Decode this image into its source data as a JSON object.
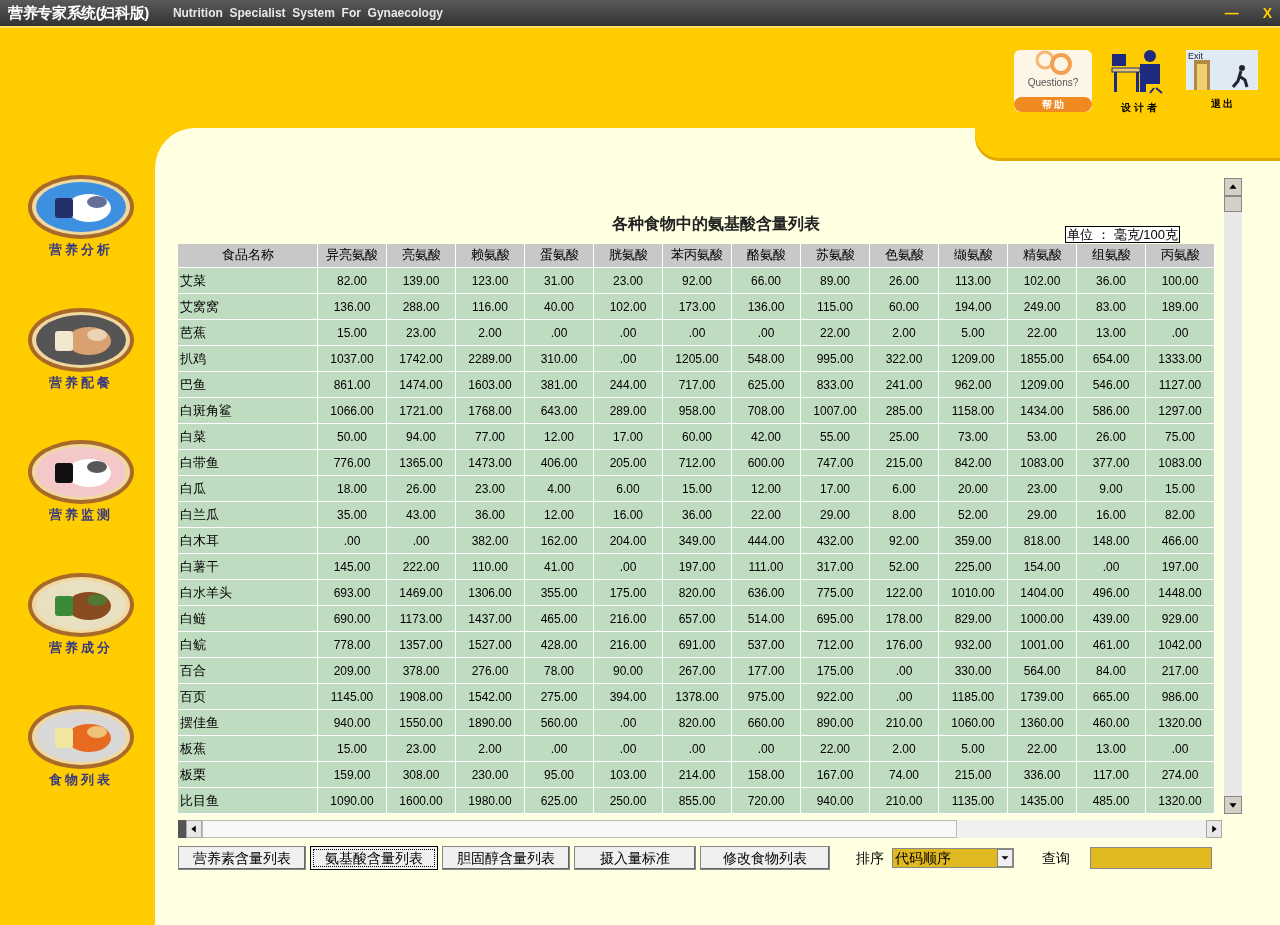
{
  "window": {
    "title": "营养专家系统(妇科版)",
    "subtitle": "Nutrition  Specialist  System  For  Gynaecology",
    "minimize": "—",
    "close": "X"
  },
  "toolbar": [
    {
      "kind": "help",
      "caption": "Questions?",
      "label": "帮 助"
    },
    {
      "kind": "designer",
      "label": "设 计 者"
    },
    {
      "kind": "exit",
      "caption": "Exit",
      "label": "退 出"
    }
  ],
  "sidebar": [
    {
      "kind": "analysis",
      "label": "营养分析"
    },
    {
      "kind": "meal",
      "label": "营养配餐"
    },
    {
      "kind": "monitor",
      "label": "营养监测"
    },
    {
      "kind": "ingredients",
      "label": "营养成分"
    },
    {
      "kind": "foods",
      "label": "食物列表"
    }
  ],
  "table": {
    "title": "各种食物中的氨基酸含量列表",
    "unit": "单位 ： 毫克/100克",
    "columns": [
      "食品名称",
      "异亮氨酸",
      "亮氨酸",
      "赖氨酸",
      "蛋氨酸",
      "胱氨酸",
      "苯丙氨酸",
      "酪氨酸",
      "苏氨酸",
      "色氨酸",
      "缬氨酸",
      "精氨酸",
      "组氨酸",
      "丙氨酸"
    ],
    "rows": [
      {
        "name": "艾菜",
        "values": [
          "82.00",
          "139.00",
          "123.00",
          "31.00",
          "23.00",
          "92.00",
          "66.00",
          "89.00",
          "26.00",
          "113.00",
          "102.00",
          "36.00",
          "100.00"
        ]
      },
      {
        "name": "艾窝窝",
        "values": [
          "136.00",
          "288.00",
          "116.00",
          "40.00",
          "102.00",
          "173.00",
          "136.00",
          "115.00",
          "60.00",
          "194.00",
          "249.00",
          "83.00",
          "189.00"
        ]
      },
      {
        "name": "芭蕉",
        "values": [
          "15.00",
          "23.00",
          "2.00",
          ".00",
          ".00",
          ".00",
          ".00",
          "22.00",
          "2.00",
          "5.00",
          "22.00",
          "13.00",
          ".00"
        ]
      },
      {
        "name": "扒鸡",
        "values": [
          "1037.00",
          "1742.00",
          "2289.00",
          "310.00",
          ".00",
          "1205.00",
          "548.00",
          "995.00",
          "322.00",
          "1209.00",
          "1855.00",
          "654.00",
          "1333.00"
        ]
      },
      {
        "name": "巴鱼",
        "values": [
          "861.00",
          "1474.00",
          "1603.00",
          "381.00",
          "244.00",
          "717.00",
          "625.00",
          "833.00",
          "241.00",
          "962.00",
          "1209.00",
          "546.00",
          "1127.00"
        ]
      },
      {
        "name": "白斑角鲨",
        "values": [
          "1066.00",
          "1721.00",
          "1768.00",
          "643.00",
          "289.00",
          "958.00",
          "708.00",
          "1007.00",
          "285.00",
          "1158.00",
          "1434.00",
          "586.00",
          "1297.00"
        ]
      },
      {
        "name": "白菜",
        "values": [
          "50.00",
          "94.00",
          "77.00",
          "12.00",
          "17.00",
          "60.00",
          "42.00",
          "55.00",
          "25.00",
          "73.00",
          "53.00",
          "26.00",
          "75.00"
        ]
      },
      {
        "name": "白带鱼",
        "values": [
          "776.00",
          "1365.00",
          "1473.00",
          "406.00",
          "205.00",
          "712.00",
          "600.00",
          "747.00",
          "215.00",
          "842.00",
          "1083.00",
          "377.00",
          "1083.00"
        ]
      },
      {
        "name": "白瓜",
        "values": [
          "18.00",
          "26.00",
          "23.00",
          "4.00",
          "6.00",
          "15.00",
          "12.00",
          "17.00",
          "6.00",
          "20.00",
          "23.00",
          "9.00",
          "15.00"
        ]
      },
      {
        "name": "白兰瓜",
        "values": [
          "35.00",
          "43.00",
          "36.00",
          "12.00",
          "16.00",
          "36.00",
          "22.00",
          "29.00",
          "8.00",
          "52.00",
          "29.00",
          "16.00",
          "82.00"
        ]
      },
      {
        "name": "白木耳",
        "values": [
          ".00",
          ".00",
          "382.00",
          "162.00",
          "204.00",
          "349.00",
          "444.00",
          "432.00",
          "92.00",
          "359.00",
          "818.00",
          "148.00",
          "466.00"
        ]
      },
      {
        "name": "白薯干",
        "values": [
          "145.00",
          "222.00",
          "110.00",
          "41.00",
          ".00",
          "197.00",
          "111.00",
          "317.00",
          "52.00",
          "225.00",
          "154.00",
          ".00",
          "197.00"
        ]
      },
      {
        "name": "白水羊头",
        "values": [
          "693.00",
          "1469.00",
          "1306.00",
          "355.00",
          "175.00",
          "820.00",
          "636.00",
          "775.00",
          "122.00",
          "1010.00",
          "1404.00",
          "496.00",
          "1448.00"
        ]
      },
      {
        "name": "白鲢",
        "values": [
          "690.00",
          "1173.00",
          "1437.00",
          "465.00",
          "216.00",
          "657.00",
          "514.00",
          "695.00",
          "178.00",
          "829.00",
          "1000.00",
          "439.00",
          "929.00"
        ]
      },
      {
        "name": "白鲩",
        "values": [
          "778.00",
          "1357.00",
          "1527.00",
          "428.00",
          "216.00",
          "691.00",
          "537.00",
          "712.00",
          "176.00",
          "932.00",
          "1001.00",
          "461.00",
          "1042.00"
        ]
      },
      {
        "name": "百合",
        "values": [
          "209.00",
          "378.00",
          "276.00",
          "78.00",
          "90.00",
          "267.00",
          "177.00",
          "175.00",
          ".00",
          "330.00",
          "564.00",
          "84.00",
          "217.00"
        ]
      },
      {
        "name": "百页",
        "values": [
          "1145.00",
          "1908.00",
          "1542.00",
          "275.00",
          "394.00",
          "1378.00",
          "975.00",
          "922.00",
          ".00",
          "1185.00",
          "1739.00",
          "665.00",
          "986.00"
        ]
      },
      {
        "name": "摆佳鱼",
        "values": [
          "940.00",
          "1550.00",
          "1890.00",
          "560.00",
          ".00",
          "820.00",
          "660.00",
          "890.00",
          "210.00",
          "1060.00",
          "1360.00",
          "460.00",
          "1320.00"
        ]
      },
      {
        "name": "板蕉",
        "values": [
          "15.00",
          "23.00",
          "2.00",
          ".00",
          ".00",
          ".00",
          ".00",
          "22.00",
          "2.00",
          "5.00",
          "22.00",
          "13.00",
          ".00"
        ]
      },
      {
        "name": "板栗",
        "values": [
          "159.00",
          "308.00",
          "230.00",
          "95.00",
          "103.00",
          "214.00",
          "158.00",
          "167.00",
          "74.00",
          "215.00",
          "336.00",
          "117.00",
          "274.00"
        ]
      },
      {
        "name": "比目鱼",
        "values": [
          "1090.00",
          "1600.00",
          "1980.00",
          "625.00",
          "250.00",
          "855.00",
          "720.00",
          "940.00",
          "210.00",
          "1135.00",
          "1435.00",
          "485.00",
          "1320.00"
        ]
      }
    ]
  },
  "tabs": [
    {
      "label": "营养素含量列表",
      "selected": false
    },
    {
      "label": "氨基酸含量列表",
      "selected": true
    },
    {
      "label": "胆固醇含量列表",
      "selected": false
    },
    {
      "label": "摄入量标准",
      "selected": false
    },
    {
      "label": "修改食物列表",
      "selected": false
    }
  ],
  "sort": {
    "label": "排序",
    "value": "代码顺序"
  },
  "query": {
    "label": "查询"
  }
}
